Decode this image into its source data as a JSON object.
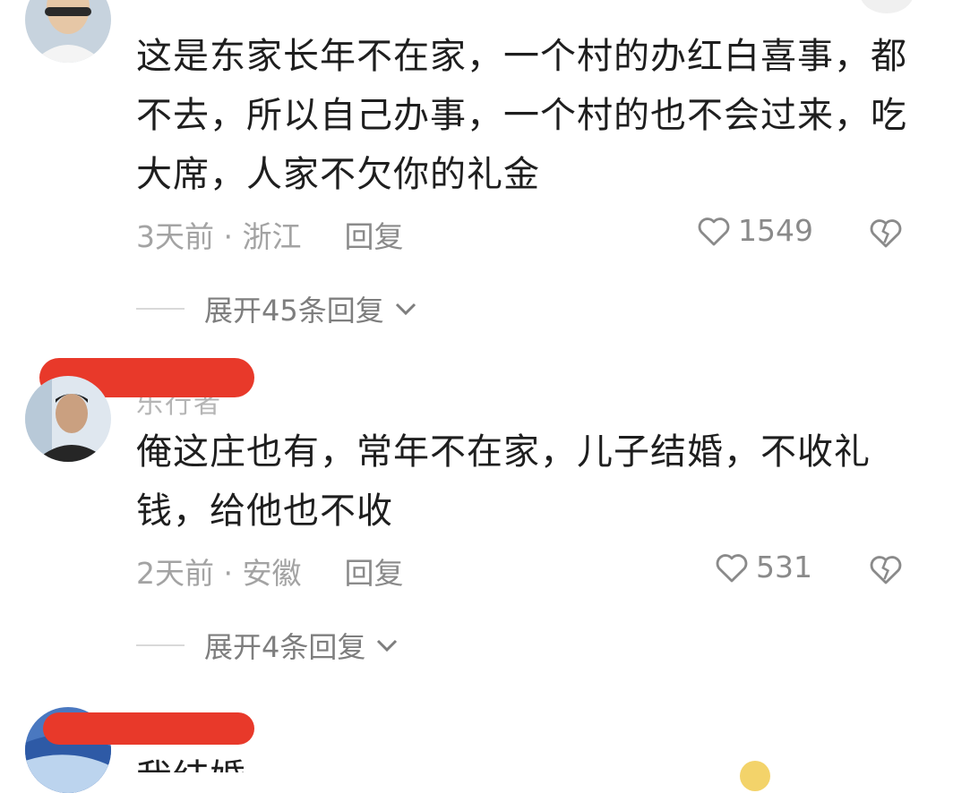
{
  "comments": [
    {
      "text": "这是东家长年不在家，一个村的办红白喜事，都不去，所以自己办事，一个村的也不会过来，吃大席，人家不欠你的礼金",
      "time_location": "3天前 · 浙江",
      "reply_label": "回复",
      "likes": "1549",
      "expand_label": "展开45条回复"
    },
    {
      "username": "乐行者",
      "text": "俺这庄也有，常年不在家，儿子结婚，不收礼钱，给他也不收",
      "time_location": "2天前 · 安徽",
      "reply_label": "回复",
      "likes": "531",
      "expand_label": "展开4条回复"
    },
    {
      "text": "我结婚…"
    }
  ],
  "icons": {
    "like": "heart-outline-icon",
    "dislike": "broken-heart-icon",
    "expand": "chevron-down-icon"
  },
  "colors": {
    "redaction": "#e8392a",
    "text": "#1e1e1e",
    "meta": "#a3a3a3"
  }
}
